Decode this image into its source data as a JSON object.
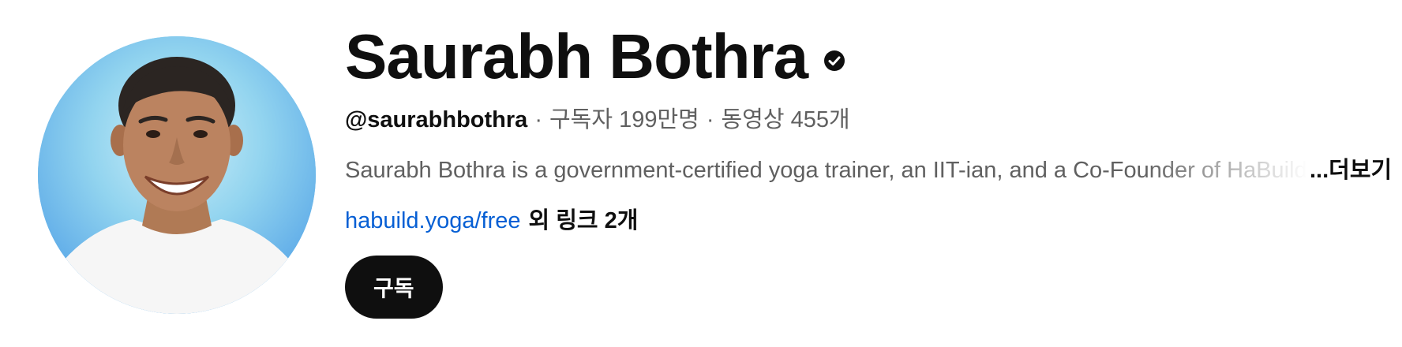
{
  "channel": {
    "name": "Saurabh Bothra",
    "verified_icon": "verified-check-icon",
    "handle": "@saurabhbothra",
    "separator": "·",
    "subscribers": "구독자 199만명",
    "videos": "동영상 455개",
    "description": "Saurabh Bothra is a government-certified yoga trainer, an IIT-ian, and a Co-Founder of HaBuild",
    "more_label": "...더보기",
    "primary_link": "habuild.yoga/free",
    "other_links": "외 링크 2개",
    "subscribe_label": "구독"
  },
  "colors": {
    "link": "#065fd4",
    "text_primary": "#0f0f0f",
    "text_secondary": "#606060",
    "button_bg": "#0f0f0f",
    "avatar_bg": "#5aa9ea"
  }
}
